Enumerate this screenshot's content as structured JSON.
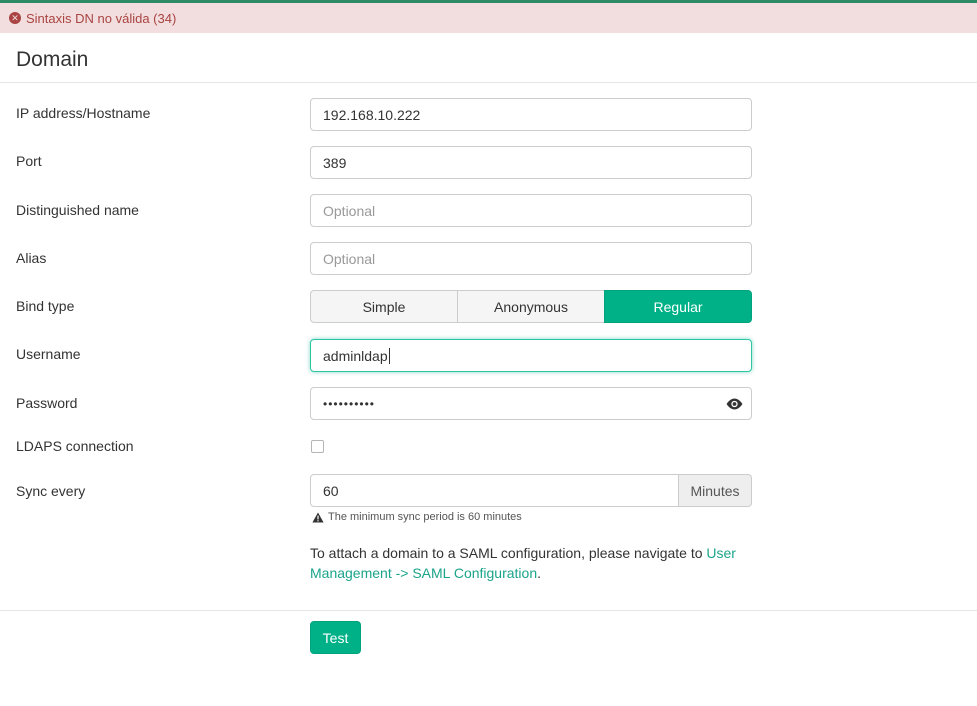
{
  "colors": {
    "accent": "#00b188",
    "error_bg": "#f2dede",
    "error_text": "#a94442",
    "link": "#1ba48a"
  },
  "error": {
    "icon": "error-circle-icon",
    "message": "Sintaxis DN no válida (34)"
  },
  "header": {
    "title": "Domain"
  },
  "form": {
    "host": {
      "label": "IP address/Hostname",
      "value": "192.168.10.222"
    },
    "port": {
      "label": "Port",
      "value": "389"
    },
    "dn": {
      "label": "Distinguished name",
      "placeholder": "Optional"
    },
    "alias": {
      "label": "Alias",
      "placeholder": "Optional"
    },
    "bind_type": {
      "label": "Bind type",
      "options": [
        "Simple",
        "Anonymous",
        "Regular"
      ],
      "selected": "Regular"
    },
    "username": {
      "label": "Username",
      "value": "adminldap"
    },
    "password": {
      "label": "Password",
      "masked": "••••••••••",
      "toggle_icon": "eye-icon"
    },
    "ldaps": {
      "label": "LDAPS connection",
      "checked": false
    },
    "sync": {
      "label": "Sync every",
      "value": "60",
      "unit": "Minutes",
      "help": "The minimum sync period is 60 minutes",
      "help_icon": "warning-icon"
    }
  },
  "info": {
    "text": "To attach a domain to a SAML configuration, please navigate to ",
    "link": "User Management -> SAML Configuration",
    "suffix": "."
  },
  "actions": {
    "test_label": "Test"
  }
}
